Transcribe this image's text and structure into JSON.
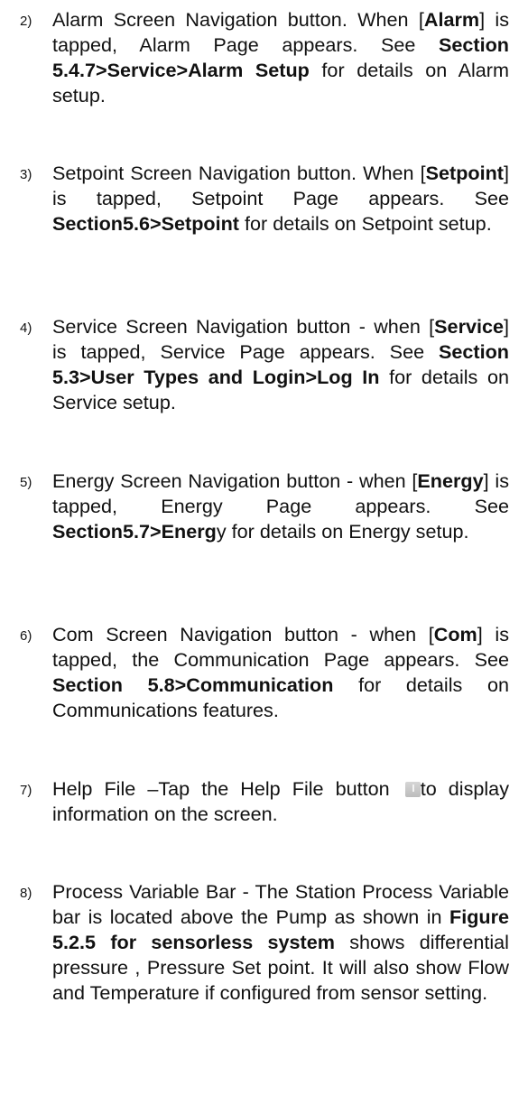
{
  "items": [
    {
      "number": "2)",
      "t1": "Alarm Screen Navigation button. When [",
      "b1": "Alarm",
      "t2": "] is tapped, Alarm Page appears. See ",
      "b2": "Section 5.4.7>Service>Alarm Setup",
      "t3": " for details on Alarm setup."
    },
    {
      "number": "3)",
      "t1": "Setpoint Screen Navigation button. When [",
      "b1": "Setpoint",
      "t2": "] is tapped, Setpoint Page appears. See ",
      "b2": "Section5.6>Setpoint",
      "t3": " for details on Setpoint setup."
    },
    {
      "number": "4)",
      "t1": "Service Screen Navigation button - when [",
      "b1": "Service",
      "t2": "] is tapped, Service Page appears. See ",
      "b2": "Section 5.3>User Types and Login>Log In",
      "t3": " for details on Service setup."
    },
    {
      "number": "5)",
      "t1": "Energy Screen Navigation button - when [",
      "b1": "Energy",
      "t2": "] is tapped, Energy Page appears. See ",
      "b2": "Section5.7>Energ",
      "t3": "y for details on Energy setup."
    },
    {
      "number": "6)",
      "t1": "Com Screen Navigation button - when [",
      "b1": "Com",
      "t2": "] is tapped, the Communication Page appears. See ",
      "b2": "Section 5.8>Communication",
      "t3": " for details on Communications features."
    },
    {
      "number": "7)",
      "t1": "Help File –Tap the Help File button ",
      "icon": "help-file-info-icon",
      "t2": "to display information on the screen."
    },
    {
      "number": "8)",
      "t1": "Process Variable Bar - The Station Process Variable bar is located above the Pump as shown in ",
      "b1": "Figure 5.2.5 for sensorless system",
      "t2": " shows differential pressure , Pressure Set point. It will also show Flow and Temperature if configured from sensor setting."
    }
  ]
}
